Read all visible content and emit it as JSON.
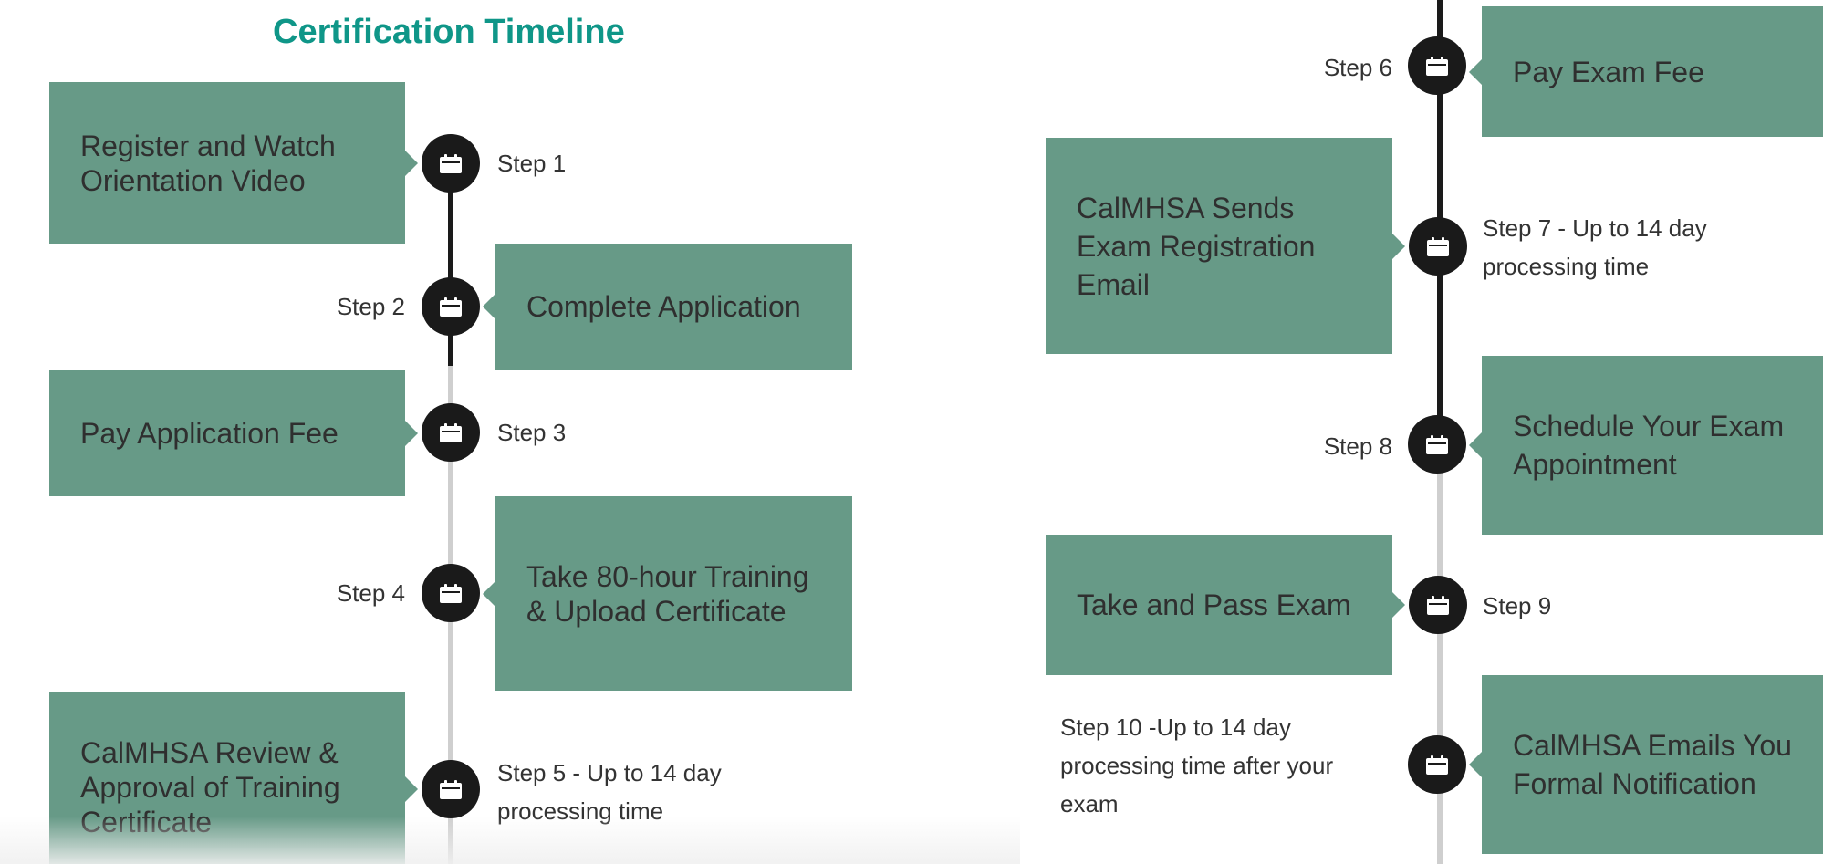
{
  "title": "Certification Timeline",
  "steps": [
    {
      "step": "Step 1",
      "label": "Register and Watch Orientation Video"
    },
    {
      "step": "Step 2",
      "label": "Complete Application"
    },
    {
      "step": "Step 3",
      "label": "Pay Application Fee"
    },
    {
      "step": "Step 4",
      "label": "Take 80-hour Training & Upload Certificate"
    },
    {
      "step": "Step 5 - Up to 14 day processing time",
      "label": "CalMHSA Review & Approval of Training Certificate"
    },
    {
      "step": "Step 6",
      "label": "Pay Exam Fee"
    },
    {
      "step": "Step 7 - Up to 14 day processing time",
      "label": "CalMHSA Sends Exam Registration Email"
    },
    {
      "step": "Step 8",
      "label": "Schedule Your Exam Appointment"
    },
    {
      "step": "Step 9",
      "label": "Take and Pass Exam"
    },
    {
      "step": "Step 10 -Up to 14 day processing time after your exam",
      "label": "CalMHSA Emails You Formal Notification"
    }
  ],
  "icon": "calendar-icon",
  "colors": {
    "accent": "#0f9688",
    "box": "#679a87",
    "line_done": "#1a1a1a",
    "line_pending": "#cfcfcf"
  }
}
